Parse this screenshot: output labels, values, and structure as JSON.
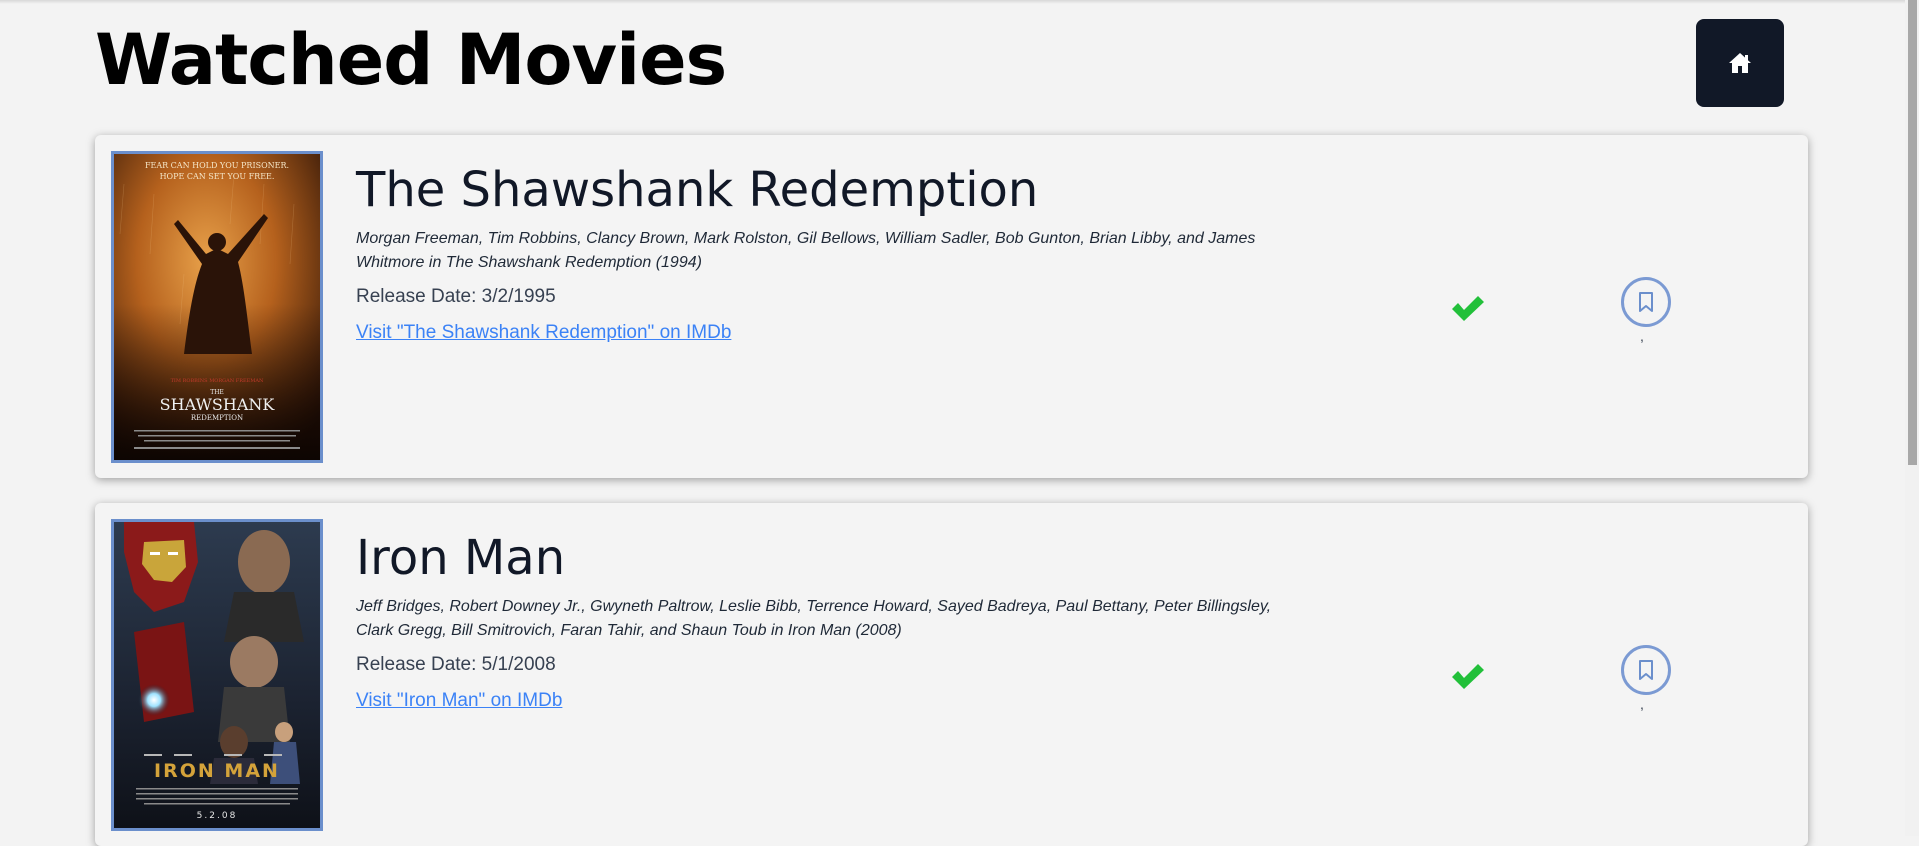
{
  "header": {
    "title": "Watched Movies",
    "home_icon": "home-icon"
  },
  "movies": [
    {
      "title": "The Shawshank Redemption",
      "cast": "Morgan Freeman, Tim Robbins, Clancy Brown, Mark Rolston, Gil Bellows, William Sadler, Bob Gunton, Brian Libby, and James Whitmore in The Shawshank Redemption (1994)",
      "release_label": "Release Date: 3/2/1995",
      "imdb_link": "Visit \"The Shawshank Redemption\" on IMDb",
      "watched_icon": "check-icon",
      "bookmark_icon": "bookmark-icon",
      "bookmark_count": ",",
      "poster": {
        "top_text_1": "FEAR CAN HOLD YOU PRISONER.",
        "top_text_2": "HOPE CAN SET YOU FREE.",
        "actors": "TIM ROBBINS    MORGAN FREEMAN",
        "name_small": "THE",
        "name_large": "SHAWSHANK",
        "name_sub": "REDEMPTION"
      }
    },
    {
      "title": "Iron Man",
      "cast": "Jeff Bridges, Robert Downey Jr., Gwyneth Paltrow, Leslie Bibb, Terrence Howard, Sayed Badreya, Paul Bettany, Peter Billingsley, Clark Gregg, Bill Smitrovich, Faran Tahir, and Shaun Toub in Iron Man (2008)",
      "release_label": "Release Date: 5/1/2008",
      "imdb_link": "Visit \"Iron Man\" on IMDb",
      "watched_icon": "check-icon",
      "bookmark_icon": "bookmark-icon",
      "bookmark_count": ",",
      "poster": {
        "name_large": "IRON MAN",
        "date": "5.2.08"
      }
    }
  ],
  "colors": {
    "background": "#f3f3f3",
    "dark_button": "#111827",
    "link": "#3b82f6",
    "check": "#22c03a",
    "poster_border": "#6b8fcc"
  }
}
